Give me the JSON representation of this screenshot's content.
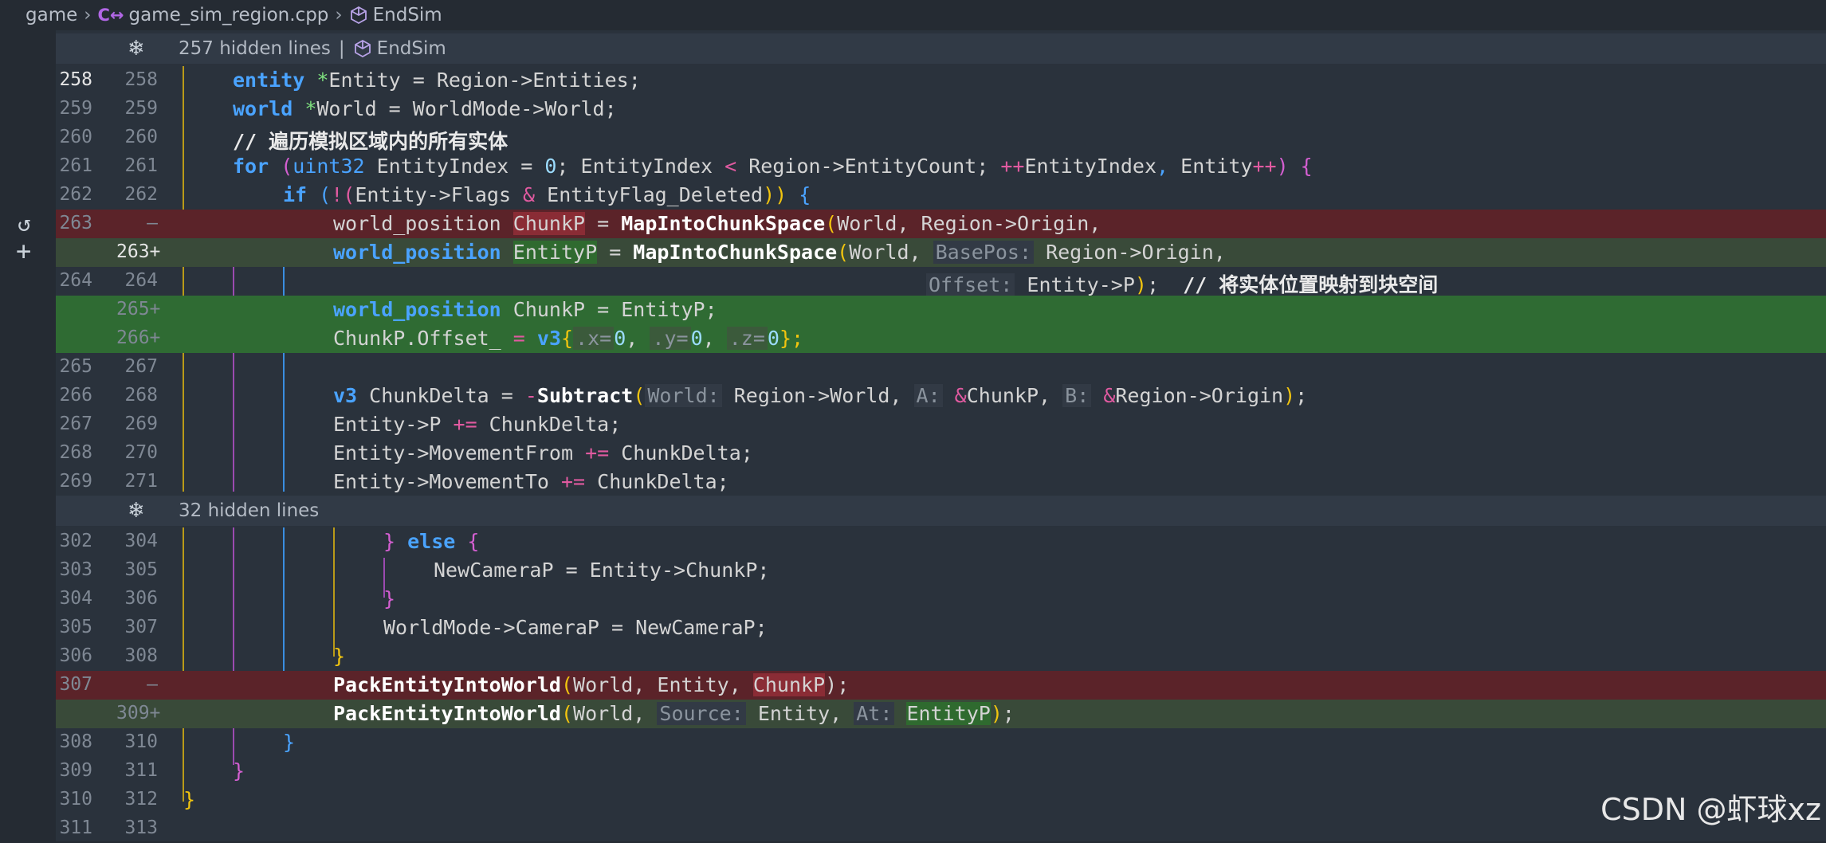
{
  "breadcrumb": {
    "folder": "game",
    "file": "game_sim_region.cpp",
    "symbol": "EndSim"
  },
  "hidden_bars": [
    {
      "count_label": "257 hidden lines",
      "separator": "|",
      "symbol": "EndSim"
    },
    {
      "count_label": "32 hidden lines"
    }
  ],
  "lines": [
    {
      "old": "258",
      "new": "258"
    },
    {
      "old": "259",
      "new": "259"
    },
    {
      "old": "260",
      "new": "260"
    },
    {
      "old": "261",
      "new": "261"
    },
    {
      "old": "262",
      "new": "262"
    },
    {
      "old": "263",
      "new": "—"
    },
    {
      "old": "",
      "new": "263+"
    },
    {
      "old": "264",
      "new": "264"
    },
    {
      "old": "",
      "new": "265+"
    },
    {
      "old": "",
      "new": "266+"
    },
    {
      "old": "265",
      "new": "267"
    },
    {
      "old": "266",
      "new": "268"
    },
    {
      "old": "267",
      "new": "269"
    },
    {
      "old": "268",
      "new": "270"
    },
    {
      "old": "269",
      "new": "271"
    },
    {
      "old": "302",
      "new": "304"
    },
    {
      "old": "303",
      "new": "305"
    },
    {
      "old": "304",
      "new": "306"
    },
    {
      "old": "305",
      "new": "307"
    },
    {
      "old": "306",
      "new": "308"
    },
    {
      "old": "307",
      "new": "—"
    },
    {
      "old": "",
      "new": "309+"
    },
    {
      "old": "308",
      "new": "310"
    },
    {
      "old": "309",
      "new": "311"
    },
    {
      "old": "310",
      "new": "312"
    },
    {
      "old": "311",
      "new": "313"
    }
  ],
  "code": {
    "l258": {
      "t1": "entity",
      "t2": " *",
      "t3": "Entity = Region->Entities;"
    },
    "l259": {
      "t1": "world",
      "t2": " *",
      "t3": "World = WorldMode->World;"
    },
    "l260": {
      "slashes": "// ",
      "comment": "遍历模拟区域内的所有实体"
    },
    "l261": {
      "kw": "for",
      "p1": " (",
      "type": "uint32",
      "a": " EntityIndex = ",
      "zero": "0",
      "b": "; EntityIndex ",
      "lt": "<",
      "c": " Region->EntityCount; ",
      "pp": "++",
      "d": "EntityIndex",
      "comma": ",",
      "e": " Entity",
      "pp2": "++",
      "close": ")",
      "brace": " {"
    },
    "l262": {
      "kw": "if",
      "p": " (",
      "bang": "!(",
      "a": "Entity->Flags ",
      "amp": "&",
      "b": " EntityFlag_Deleted",
      "c": "))",
      "brace": " {"
    },
    "l263d": {
      "type": "world_position ",
      "var": "ChunkP",
      "eq": " = ",
      "fn": "MapIntoChunkSpace",
      "p": "(",
      "args": "World, Region->Origin,"
    },
    "l263a": {
      "type": "world_position",
      "sp": " ",
      "var": "EntityP",
      "eq": " = ",
      "fn": "MapIntoChunkSpace",
      "p": "(",
      "a": "World, ",
      "hint": "BasePos:",
      "b": " Region->Origin,"
    },
    "l264": {
      "hint": "Offset:",
      "a": " Entity->P",
      "p": ")",
      "semi": ";  ",
      "slashes": "// ",
      "comment": "将实体位置映射到块空间"
    },
    "l265a": {
      "type": "world_position",
      "rest": " ChunkP = EntityP;"
    },
    "l266a": {
      "a": "ChunkP.Offset_ ",
      "eq": "=",
      "sp": " ",
      "v3": "v3",
      "b": "{",
      "hx": ".x=",
      "x": "0",
      "c1": ", ",
      "hy": ".y=",
      "y": "0",
      "c2": ", ",
      "hz": ".z=",
      "z": "0",
      "e": "};"
    },
    "l268": {
      "v3": "v3",
      "a": " ChunkDelta = ",
      "minus": "-",
      "fn": "Subtract",
      "p": "(",
      "hw": "World:",
      "b": " Region->World, ",
      "ha": "A:",
      "amp1": " &",
      "c": "ChunkP, ",
      "hb": "B:",
      "amp2": " &",
      "d": "Region->Origin",
      "p2": ")",
      "e": ";"
    },
    "l269": {
      "a": "Entity->P ",
      "op": "+=",
      "b": " ChunkDelta;"
    },
    "l270": {
      "a": "Entity->MovementFrom ",
      "op": "+=",
      "b": " ChunkDelta;"
    },
    "l271": {
      "a": "Entity->MovementTo ",
      "op": "+=",
      "b": " ChunkDelta;"
    },
    "l304": {
      "rb": "}",
      "sp": " ",
      "kw": "else",
      "lb": " {"
    },
    "l305": {
      "a": "NewCameraP = Entity->ChunkP;"
    },
    "l306": {
      "rb": "}"
    },
    "l307": {
      "a": "WorldMode->CameraP = NewCameraP;"
    },
    "l308": {
      "rb": "}"
    },
    "l307d": {
      "fn": "PackEntityIntoWorld",
      "p": "(",
      "a": "World, Entity, ",
      "var": "ChunkP",
      "e": ");"
    },
    "l309a": {
      "fn": "PackEntityIntoWorld",
      "p": "(",
      "a": "World, ",
      "hs": "Source:",
      "b": " Entity, ",
      "ha": "At:",
      "sp": " ",
      "var": "EntityP",
      "p2": ")",
      "e": ";"
    },
    "l310": {
      "rb": "}"
    },
    "l311": {
      "rb": "}"
    },
    "l312": {
      "rb": "}"
    }
  },
  "watermark": "CSDN @虾球xz",
  "colors": {
    "keyword": "#4aa3ff",
    "deleted_bg": "#5b2329",
    "added_bg": "#2f6b33"
  }
}
